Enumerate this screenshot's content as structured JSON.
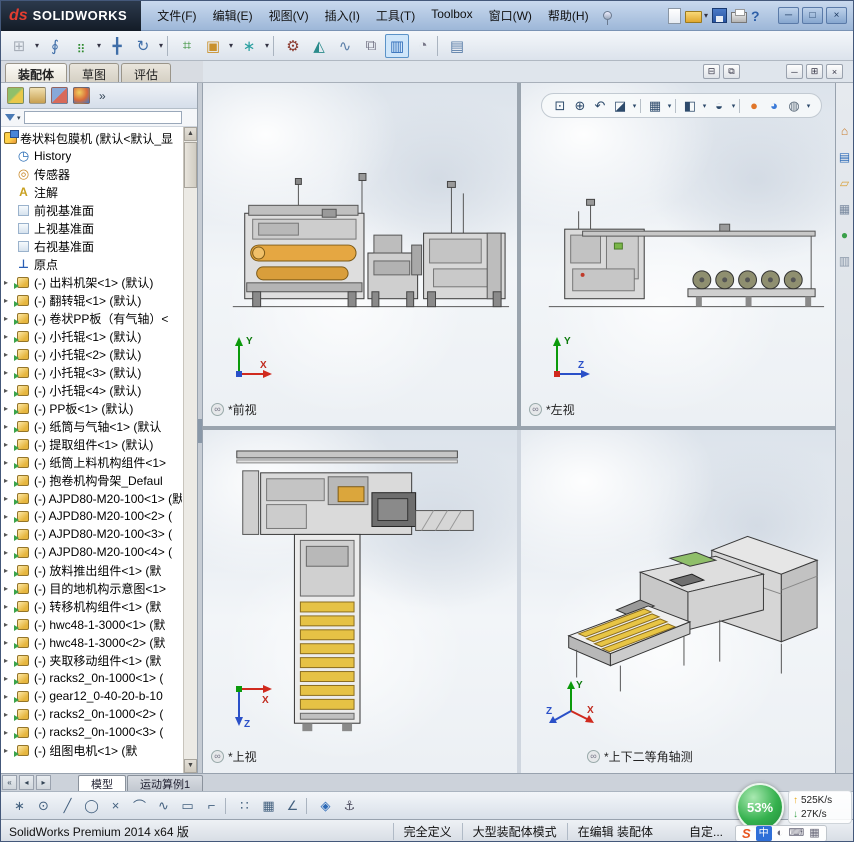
{
  "titlebar": {
    "logo_ds": "ds",
    "logo_text": "SOLIDWORKS",
    "menus": [
      "文件(F)",
      "编辑(E)",
      "视图(V)",
      "插入(I)",
      "工具(T)",
      "Toolbox",
      "窗口(W)",
      "帮助(H)"
    ]
  },
  "main_toolbar": {
    "icons": [
      {
        "n": "insert-components",
        "g": "⊞"
      },
      {
        "n": "dropdown-arrow",
        "g": "▾"
      },
      {
        "n": "mate",
        "g": "∮"
      },
      {
        "n": "linear-component-pattern",
        "g": "⣶"
      },
      {
        "n": "dropdown-arrow",
        "g": "▾"
      },
      {
        "n": "move-component",
        "g": "╋"
      },
      {
        "n": "rotate-component",
        "g": "↻"
      },
      {
        "n": "dropdown-arrow",
        "g": "▾"
      },
      {
        "n": "separator",
        "g": ""
      },
      {
        "n": "smart-fasteners",
        "g": "⌗"
      },
      {
        "n": "assembly-features",
        "g": "▣"
      },
      {
        "n": "dropdown-arrow",
        "g": "▾"
      },
      {
        "n": "reference-geometry",
        "g": "∗"
      },
      {
        "n": "dropdown-arrow",
        "g": "▾"
      },
      {
        "n": "separator",
        "g": ""
      },
      {
        "n": "belt-chain",
        "g": "⚙"
      },
      {
        "n": "exploded-view",
        "g": "◭"
      },
      {
        "n": "explode-line-sketch",
        "g": "∿"
      },
      {
        "n": "interference-detection",
        "g": "⧉"
      },
      {
        "n": "assembly-visualization",
        "g": "▥"
      },
      {
        "n": "performance-evaluation",
        "g": "◔"
      },
      {
        "n": "separator",
        "g": ""
      },
      {
        "n": "take-snapshot",
        "g": "▤"
      }
    ]
  },
  "command_tabs": [
    {
      "label": "装配体",
      "cls": "active"
    },
    {
      "label": "草图",
      "cls": ""
    },
    {
      "label": "评估",
      "cls": ""
    }
  ],
  "doc_controls": [
    {
      "n": "tile-horizontally",
      "g": "⊟"
    },
    {
      "n": "tile-vertically",
      "g": "⧉"
    },
    {
      "n": "doc-gap",
      "g": ""
    },
    {
      "n": "minimize-document",
      "g": "─"
    },
    {
      "n": "restore-document",
      "g": "⊞"
    },
    {
      "n": "close-document",
      "g": "×"
    }
  ],
  "left_panel": {
    "tabs": [
      {
        "n": "featuremanager"
      },
      {
        "n": "propertymanager"
      },
      {
        "n": "configurationmanager"
      },
      {
        "n": "displaymanager"
      }
    ],
    "overflow_chevron": "»",
    "tree": {
      "root": "卷状料包膜机 (默认<默认_显",
      "items": [
        {
          "t": "History",
          "icon": "history",
          "cls": "plain"
        },
        {
          "t": "传感器",
          "icon": "sensors",
          "cls": "plain"
        },
        {
          "t": "注解",
          "icon": "annotations",
          "cls": "plain"
        },
        {
          "t": "前视基准面",
          "icon": "plane",
          "cls": "plain"
        },
        {
          "t": "上视基准面",
          "icon": "plane",
          "cls": "plain"
        },
        {
          "t": "右视基准面",
          "icon": "plane",
          "cls": "plain"
        },
        {
          "t": "原点",
          "icon": "origin",
          "cls": "plain"
        },
        {
          "t": "(-) 出料机架<1> (默认)",
          "icon": "component",
          "cls": "comp"
        },
        {
          "t": "(-) 翻转辊<1> (默认)",
          "icon": "component",
          "cls": "comp"
        },
        {
          "t": "(-) 卷状PP板（有气轴）<",
          "icon": "component",
          "cls": "comp"
        },
        {
          "t": "(-) 小托辊<1> (默认)",
          "icon": "component",
          "cls": "comp"
        },
        {
          "t": "(-) 小托辊<2> (默认)",
          "icon": "component",
          "cls": "comp"
        },
        {
          "t": "(-) 小托辊<3> (默认)",
          "icon": "component",
          "cls": "comp"
        },
        {
          "t": "(-) 小托辊<4> (默认)",
          "icon": "component",
          "cls": "comp"
        },
        {
          "t": "(-) PP板<1> (默认)",
          "icon": "component",
          "cls": "comp"
        },
        {
          "t": "(-) 纸筒与气轴<1> (默认",
          "icon": "component",
          "cls": "comp"
        },
        {
          "t": "(-) 提取组件<1> (默认)",
          "icon": "component",
          "cls": "comp"
        },
        {
          "t": "(-) 纸筒上料机构组件<1>",
          "icon": "component",
          "cls": "comp"
        },
        {
          "t": "(-) 抱卷机构骨架_Defaul",
          "icon": "component",
          "cls": "comp"
        },
        {
          "t": "(-) AJPD80-M20-100<1> (默",
          "icon": "component",
          "cls": "comp"
        },
        {
          "t": "(-) AJPD80-M20-100<2> (",
          "icon": "component",
          "cls": "comp"
        },
        {
          "t": "(-) AJPD80-M20-100<3> (",
          "icon": "component",
          "cls": "comp"
        },
        {
          "t": "(-) AJPD80-M20-100<4> (",
          "icon": "component",
          "cls": "comp"
        },
        {
          "t": "(-) 放料推出组件<1> (默",
          "icon": "component",
          "cls": "comp"
        },
        {
          "t": "(-) 目的地机构示意图<1>",
          "icon": "component",
          "cls": "comp"
        },
        {
          "t": "(-) 转移机构组件<1> (默",
          "icon": "component",
          "cls": "comp"
        },
        {
          "t": "(-) hwc48-1-3000<1> (默",
          "icon": "component",
          "cls": "comp"
        },
        {
          "t": "(-) hwc48-1-3000<2> (默",
          "icon": "component",
          "cls": "comp"
        },
        {
          "t": "(-) 夹取移动组件<1> (默",
          "icon": "component",
          "cls": "comp"
        },
        {
          "t": "(-) racks2_0n-1000<1> (",
          "icon": "component",
          "cls": "comp"
        },
        {
          "t": "(-) gear12_0-40-20-b-10",
          "icon": "component",
          "cls": "comp"
        },
        {
          "t": "(-) racks2_0n-1000<2> (",
          "icon": "component",
          "cls": "comp"
        },
        {
          "t": "(-) racks2_0n-1000<3> (",
          "icon": "component",
          "cls": "comp"
        },
        {
          "t": "(-) 组图电机<1> (默",
          "icon": "component",
          "cls": "comp"
        }
      ]
    }
  },
  "headsup": {
    "icons": [
      {
        "n": "zoom-to-fit",
        "g": "⊡"
      },
      {
        "n": "zoom-to-area",
        "g": "⊕"
      },
      {
        "n": "previous-view",
        "g": "↶"
      },
      {
        "n": "section-view",
        "g": "◪"
      },
      {
        "n": "dropdown-arrow",
        "g": "▾"
      },
      {
        "n": "separator",
        "g": ""
      },
      {
        "n": "view-orientation",
        "g": "▦"
      },
      {
        "n": "dropdown-arrow",
        "g": "▾"
      },
      {
        "n": "separator",
        "g": ""
      },
      {
        "n": "display-style",
        "g": "◧"
      },
      {
        "n": "dropdown-arrow",
        "g": "▾"
      },
      {
        "n": "hide-show-items",
        "g": "◒"
      },
      {
        "n": "dropdown-arrow",
        "g": "▾"
      },
      {
        "n": "separator",
        "g": ""
      },
      {
        "n": "edit-appearance",
        "g": "●"
      },
      {
        "n": "apply-scene",
        "g": "◕"
      },
      {
        "n": "view-settings",
        "g": "◍"
      },
      {
        "n": "dropdown-arrow",
        "g": "▾"
      }
    ]
  },
  "viewports": [
    {
      "label": "*前视"
    },
    {
      "label": "*左视"
    },
    {
      "label": "*上视"
    },
    {
      "label": "*上下二等角轴测"
    }
  ],
  "axes": {
    "x": "X",
    "y": "Y",
    "z": "Z"
  },
  "task_pane": {
    "icons": [
      {
        "n": "solidworks-resources",
        "g": "⌂"
      },
      {
        "n": "design-library",
        "g": "▤"
      },
      {
        "n": "file-explorer",
        "g": "▱"
      },
      {
        "n": "view-palette",
        "g": "▦"
      },
      {
        "n": "appearances-scenes",
        "g": "●"
      },
      {
        "n": "custom-properties",
        "g": "▥"
      }
    ]
  },
  "bottom_tabs": {
    "nav": [
      {
        "n": "first-tab",
        "g": "«"
      },
      {
        "n": "previous-tab",
        "g": "◂"
      },
      {
        "n": "next-tab",
        "g": "▸"
      }
    ],
    "tabs": [
      {
        "label": "模型",
        "cls": "active"
      },
      {
        "label": "运动算例1",
        "cls": ""
      }
    ]
  },
  "sketch_toolbar": {
    "icons": [
      {
        "n": "sketch-point",
        "g": "∗"
      },
      {
        "n": "sketch-circle",
        "g": "⊙"
      },
      {
        "n": "sketch-line",
        "g": "╱"
      },
      {
        "n": "sketch-ellipse",
        "g": "◯"
      },
      {
        "n": "trim-entities",
        "g": "×"
      },
      {
        "n": "sketch-arc",
        "g": "⌒"
      },
      {
        "n": "sketch-spline",
        "g": "∿"
      },
      {
        "n": "sketch-rectangle",
        "g": "▭"
      },
      {
        "n": "offset-entities",
        "g": "⌐"
      },
      {
        "n": "separator",
        "g": ""
      },
      {
        "n": "sketch-pattern",
        "g": "∷"
      },
      {
        "n": "sketch-grid",
        "g": "▦"
      },
      {
        "n": "smart-dimension",
        "g": "∠"
      },
      {
        "n": "separator",
        "g": ""
      },
      {
        "n": "iso-cube",
        "g": "◈"
      },
      {
        "n": "anchor",
        "g": "⚓"
      }
    ]
  },
  "statusbar": {
    "left": "SolidWorks Premium 2014 x64 版",
    "items": [
      "完全定义",
      "大型装配体模式",
      "在编辑 装配体"
    ],
    "custom": "自定..."
  },
  "overlay": {
    "percent": "53%",
    "upload": "525K/s",
    "download": "27K/s",
    "ime_icons": [
      {
        "n": "sogou-logo",
        "g": "S"
      },
      {
        "n": "ime-language",
        "g": "中"
      },
      {
        "n": "ime-fullhalf",
        "g": "◐"
      },
      {
        "n": "ime-keyboard",
        "g": "⌨"
      },
      {
        "n": "ime-toolbox",
        "g": "▦"
      }
    ]
  }
}
